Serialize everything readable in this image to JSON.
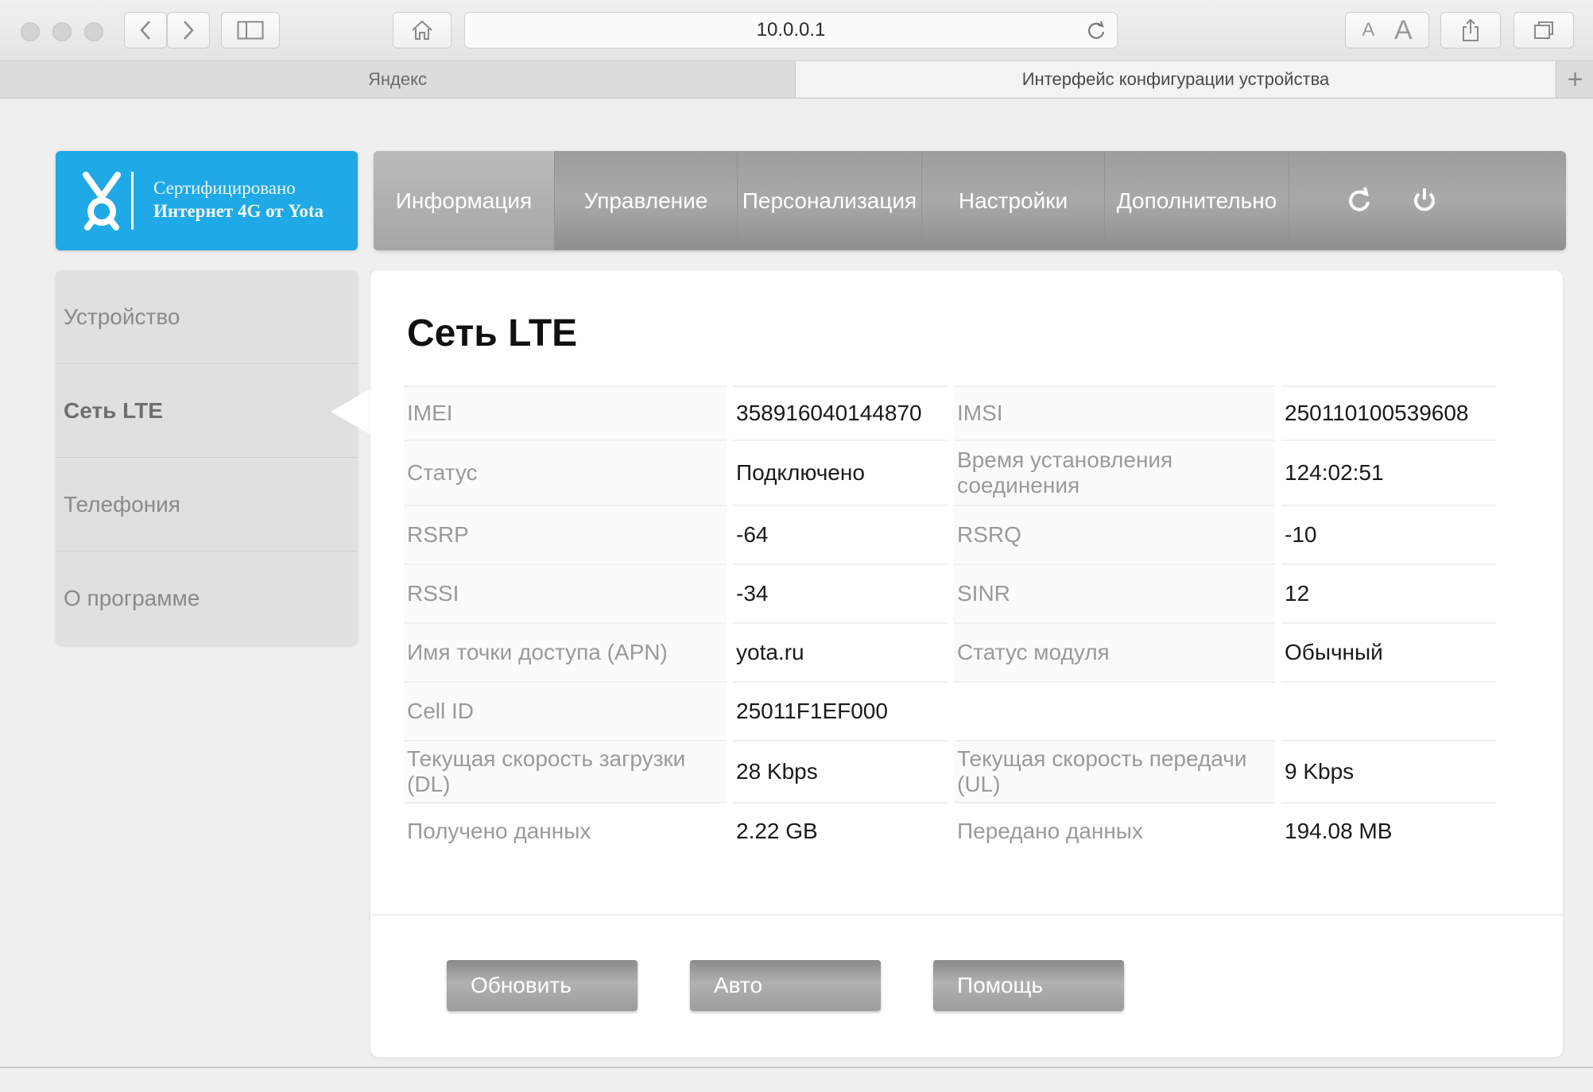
{
  "browser": {
    "url": "10.0.0.1",
    "tabs": [
      {
        "label": "Яндекс"
      },
      {
        "label": "Интерфейс конфигурации устройства"
      }
    ],
    "font_small": "A",
    "font_large": "A",
    "new_tab": "+"
  },
  "logo": {
    "line1": "Сертифицировано",
    "line2": "Интернет 4G от Yota",
    "accent": "#1fa9e6"
  },
  "topnav": {
    "items": [
      {
        "label": "Информация"
      },
      {
        "label": "Управление"
      },
      {
        "label": "Персонализация"
      },
      {
        "label": "Настройки"
      },
      {
        "label": "Дополнительно"
      }
    ],
    "icons": [
      "refresh-icon",
      "power-icon"
    ]
  },
  "sidebar": {
    "items": [
      {
        "label": "Устройство"
      },
      {
        "label": "Сеть LTE"
      },
      {
        "label": "Телефония"
      },
      {
        "label": "О программе"
      }
    ]
  },
  "main": {
    "title": "Сеть LTE",
    "rows": [
      {
        "k1": "IMEI",
        "v1": "358916040144870",
        "k2": "IMSI",
        "v2": "250110100539608"
      },
      {
        "k1": "Статус",
        "v1": "Подключено",
        "k2": "Время установления соединения",
        "v2": "124:02:51"
      },
      {
        "k1": "RSRP",
        "v1": "-64",
        "k2": "RSRQ",
        "v2": "-10"
      },
      {
        "k1": "RSSI",
        "v1": "-34",
        "k2": "SINR",
        "v2": "12"
      },
      {
        "k1": "Имя точки доступа (APN)",
        "v1": "yota.ru",
        "k2": "Статус модуля",
        "v2": "Обычный"
      },
      {
        "k1": "Cell ID",
        "v1": "25011F1EF000",
        "k2": "",
        "v2": ""
      },
      {
        "k1": "Текущая скорость загрузки (DL)",
        "v1": "28 Kbps",
        "k2": "Текущая скорость передачи (UL)",
        "v2": "9 Kbps"
      },
      {
        "k1": "Получено данных",
        "v1": "2.22 GB",
        "k2": "Передано данных",
        "v2": "194.08 MB"
      }
    ],
    "buttons": [
      {
        "label": "Обновить"
      },
      {
        "label": "Авто"
      },
      {
        "label": "Помощь"
      }
    ]
  }
}
